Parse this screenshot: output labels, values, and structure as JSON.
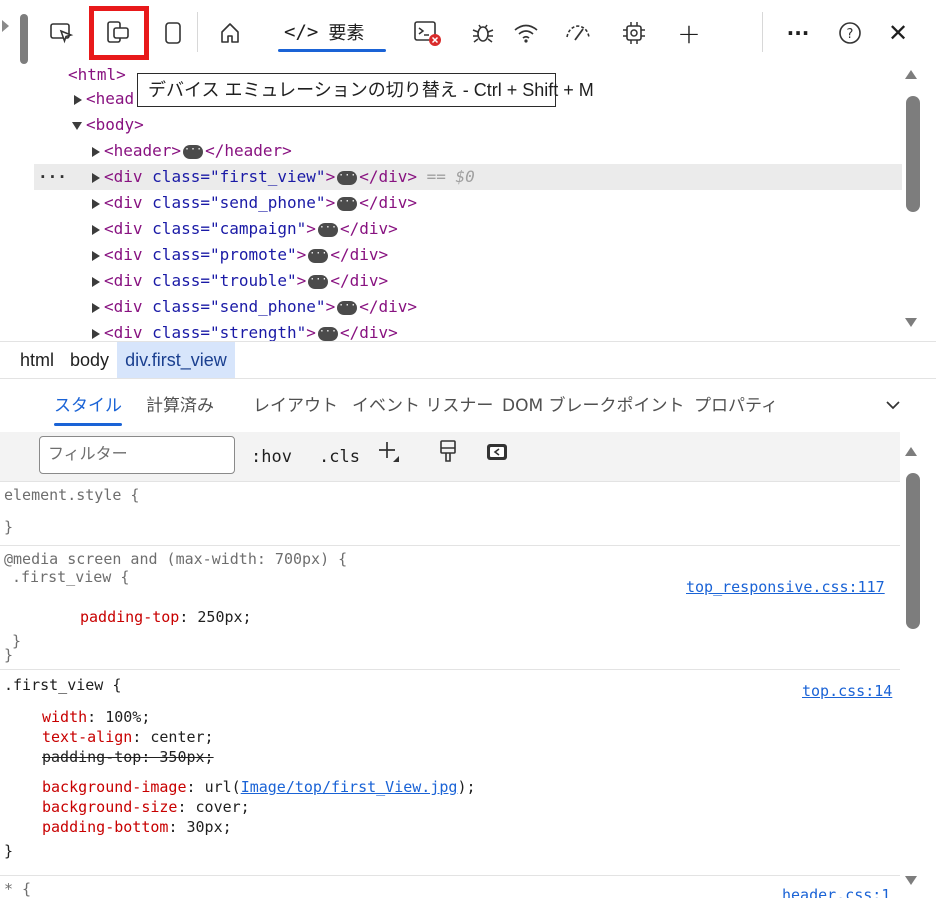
{
  "toolbar": {
    "icons": [
      "inspect-icon",
      "device-emulation-icon",
      "dock-icon",
      "welcome-home-icon",
      "elements-icon",
      "console-icon",
      "sources-bug-icon",
      "network-wifi-icon",
      "performance-icon",
      "memory-chip-icon",
      "add-tool-icon",
      "more-tools-icon",
      "help-icon",
      "close-icon"
    ],
    "elements_tab": {
      "code_glyph": "</>",
      "label": "要素"
    },
    "more_label": "···",
    "help_label": "?",
    "close_label": "✕",
    "add_label": "+",
    "accent_color": "#1a63d6",
    "highlight_color": "#e8191a"
  },
  "tooltip": {
    "text": "デバイス エミュレーションの切り替え - Ctrl + Shift + M"
  },
  "dom_tree": {
    "html_open": "<html>",
    "head_label": "<head",
    "body_open": "<body>",
    "rows": [
      {
        "open": "<header>",
        "close": "</header>"
      },
      {
        "open_pre": "<div ",
        "attr": "class=",
        "value": "\"first_view\"",
        "open_post": ">",
        "close": "</div>",
        "ref": "== $0",
        "dots": "···"
      },
      {
        "open_pre": "<div ",
        "attr": "class=",
        "value": "\"send_phone\"",
        "open_post": ">",
        "close": "</div>"
      },
      {
        "open_pre": "<div ",
        "attr": "class=",
        "value": "\"campaign\"",
        "open_post": ">",
        "close": "</div>"
      },
      {
        "open_pre": "<div ",
        "attr": "class=",
        "value": "\"promote\"",
        "open_post": ">",
        "close": "</div>"
      },
      {
        "open_pre": "<div ",
        "attr": "class=",
        "value": "\"trouble\"",
        "open_post": ">",
        "close": "</div>"
      },
      {
        "open_pre": "<div ",
        "attr": "class=",
        "value": "\"send_phone\"",
        "open_post": ">",
        "close": "</div>"
      },
      {
        "open_pre": "<div ",
        "attr": "class=",
        "value": "\"strength\"",
        "open_post": ">",
        "close": "</div>"
      }
    ]
  },
  "breadcrumb": [
    "html",
    "body",
    "div.first_view"
  ],
  "style_tabs": [
    "スタイル",
    "計算済み",
    "レイアウト",
    "イベント リスナー",
    "DOM ブレークポイント",
    "プロパティ"
  ],
  "filter": {
    "placeholder": "フィルター",
    "hov": ":hov",
    "cls": ".cls",
    "plus": "+"
  },
  "styles": {
    "element_style": {
      "open": "element.style {",
      "close": "}"
    },
    "media_rule": {
      "media": "@media",
      "query": " screen and (max-width: 700px) {",
      "selector": ".first_view {",
      "source": "top_responsive.css:117",
      "prop": "padding-top",
      "value": "250px;",
      "close_inner": "}",
      "close_outer": "}"
    },
    "first_view_rule": {
      "selector": ".first_view {",
      "source": "top.css:14",
      "decls": [
        {
          "prop": "width",
          "value": "100%;"
        },
        {
          "prop": "text-align",
          "value": "center;"
        },
        {
          "prop": "padding-top",
          "value": "350px;",
          "struck": "padding-top: 350px;"
        },
        {
          "prop": "background-image",
          "pre": "url(",
          "link": "Image/top/first_View.jpg",
          "post": ");"
        },
        {
          "prop": "background-size",
          "value": "cover;"
        },
        {
          "prop": "padding-bottom",
          "value": "30px;"
        }
      ],
      "close": "}"
    },
    "star_rule": {
      "selector": "* {",
      "source": "header.css:1"
    }
  }
}
